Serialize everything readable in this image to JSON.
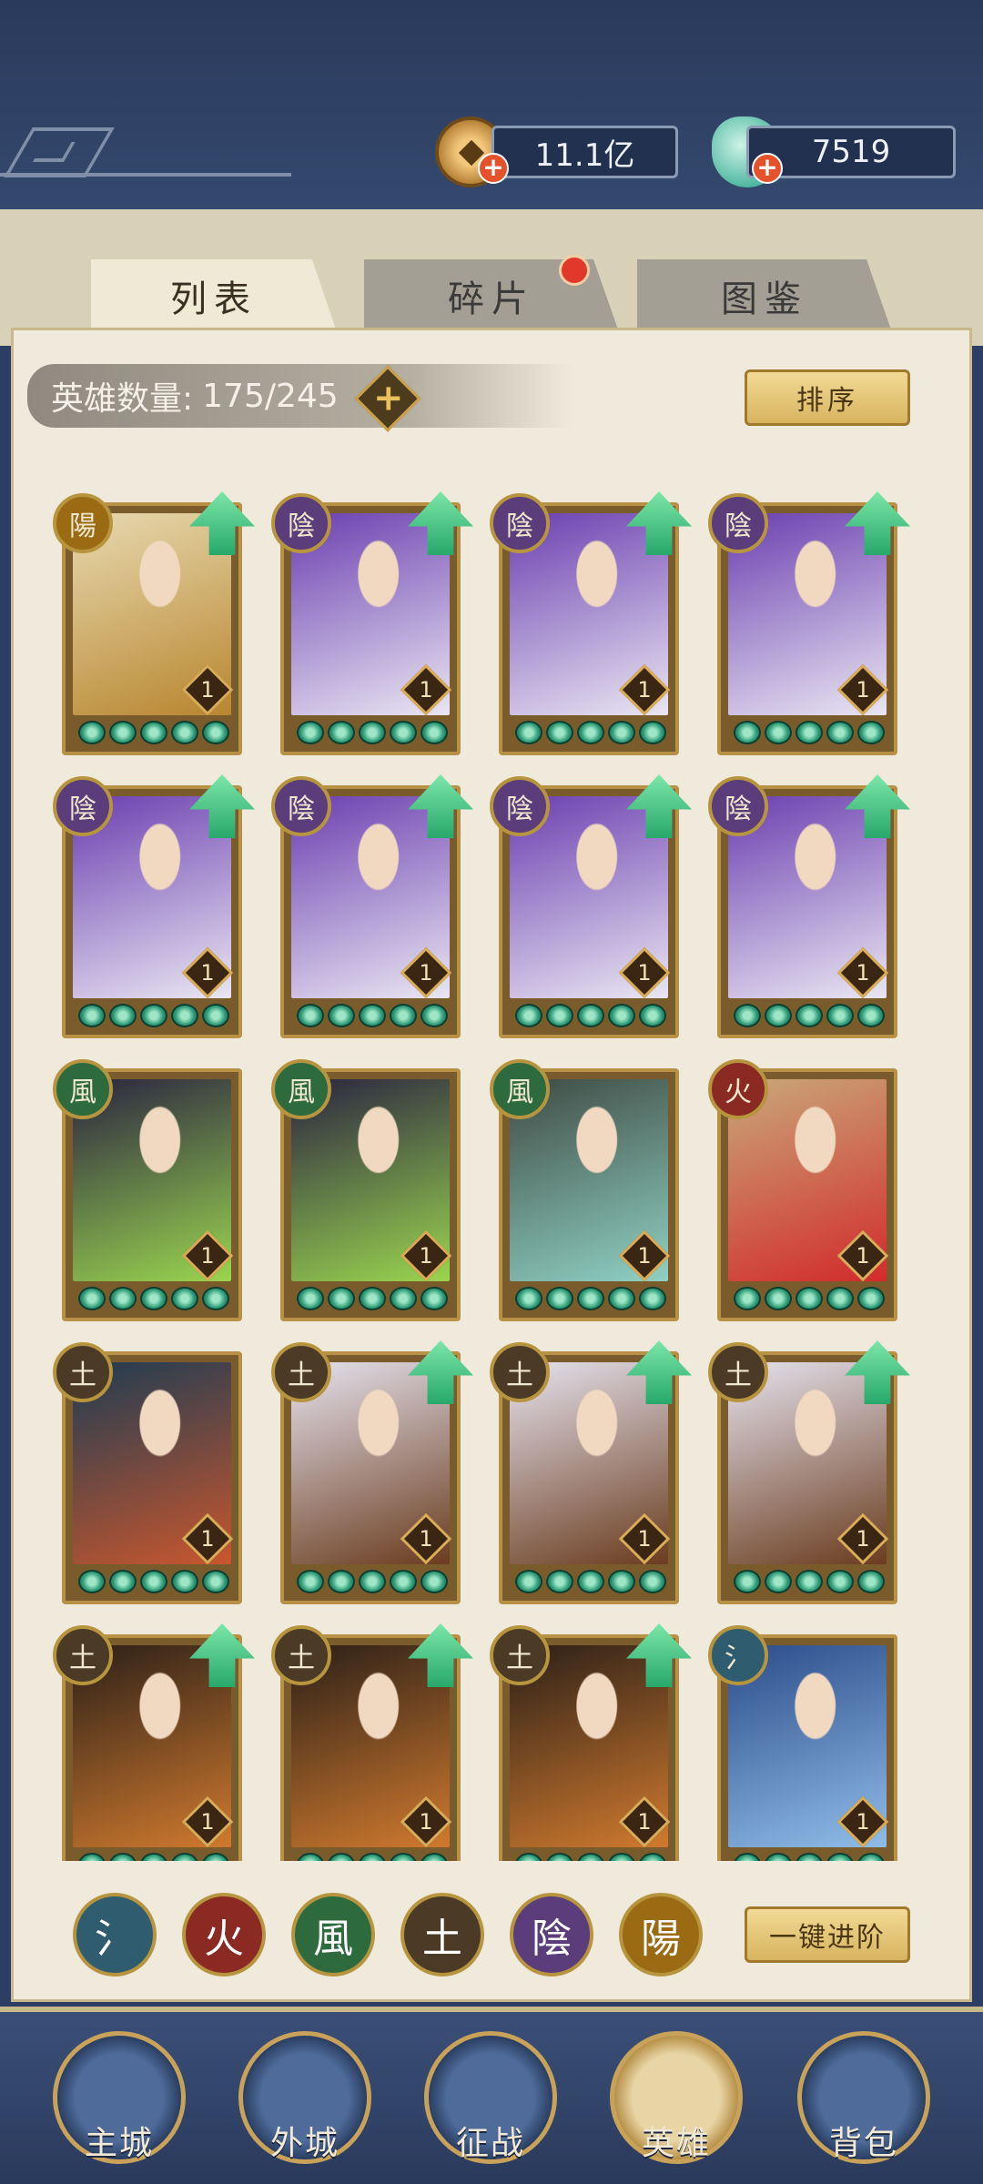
{
  "resources": {
    "coins": "11.1亿",
    "jade": "7519"
  },
  "tabs": [
    {
      "label": "列表",
      "active": true
    },
    {
      "label": "碎片",
      "active": false,
      "has_badge": true
    },
    {
      "label": "图鉴",
      "active": false
    }
  ],
  "hero_count": {
    "label": "英雄数量:",
    "value": "175/245"
  },
  "buttons": {
    "sort": "排序",
    "one_click_advance": "一键进阶"
  },
  "element_glyphs": {
    "water": "氵",
    "fire": "火",
    "wind": "風",
    "earth": "土",
    "yin": "陰",
    "yang": "陽"
  },
  "element_colors": {
    "water": "#2f5c6e",
    "fire": "#8a2a22",
    "wind": "#2d6b3e",
    "earth": "#4a3a26",
    "yin": "#5a3d7a",
    "yang": "#9a6b12"
  },
  "heroes": [
    {
      "element": "yang",
      "level": "1",
      "stars": 5,
      "upgrade": true,
      "art": "yellow-robed-lady"
    },
    {
      "element": "yin",
      "level": "1",
      "stars": 5,
      "upgrade": true,
      "art": "purple-ninja"
    },
    {
      "element": "yin",
      "level": "1",
      "stars": 5,
      "upgrade": true,
      "art": "purple-ninja"
    },
    {
      "element": "yin",
      "level": "1",
      "stars": 5,
      "upgrade": true,
      "art": "purple-ninja"
    },
    {
      "element": "yin",
      "level": "1",
      "stars": 5,
      "upgrade": true,
      "art": "purple-ninja"
    },
    {
      "element": "yin",
      "level": "1",
      "stars": 5,
      "upgrade": true,
      "art": "purple-ninja"
    },
    {
      "element": "yin",
      "level": "1",
      "stars": 5,
      "upgrade": true,
      "art": "purple-ninja"
    },
    {
      "element": "yin",
      "level": "1",
      "stars": 5,
      "upgrade": true,
      "art": "purple-ninja"
    },
    {
      "element": "wind",
      "level": "1",
      "stars": 5,
      "upgrade": false,
      "art": "twin-tail-girl"
    },
    {
      "element": "wind",
      "level": "1",
      "stars": 5,
      "upgrade": false,
      "art": "twin-tail-girl"
    },
    {
      "element": "wind",
      "level": "1",
      "stars": 5,
      "upgrade": false,
      "art": "long-hair-swordsman"
    },
    {
      "element": "fire",
      "level": "1",
      "stars": 5,
      "upgrade": false,
      "art": "red-dress-girl"
    },
    {
      "element": "earth",
      "level": "1",
      "stars": 5,
      "upgrade": false,
      "art": "scarf-youth"
    },
    {
      "element": "earth",
      "level": "1",
      "stars": 5,
      "upgrade": true,
      "art": "bearded-general"
    },
    {
      "element": "earth",
      "level": "1",
      "stars": 5,
      "upgrade": true,
      "art": "bearded-general"
    },
    {
      "element": "earth",
      "level": "1",
      "stars": 5,
      "upgrade": true,
      "art": "bearded-general"
    },
    {
      "element": "earth",
      "level": "1",
      "stars": 5,
      "upgrade": true,
      "art": "leaf-dancer"
    },
    {
      "element": "earth",
      "level": "1",
      "stars": 5,
      "upgrade": true,
      "art": "leaf-dancer"
    },
    {
      "element": "earth",
      "level": "1",
      "stars": 5,
      "upgrade": true,
      "art": "leaf-dancer"
    },
    {
      "element": "water",
      "level": "1",
      "stars": 5,
      "upgrade": false,
      "art": "blue-opera-lady"
    }
  ],
  "art_colors": {
    "yellow-robed-lady": [
      "#e7d9b0",
      "#b8862f"
    ],
    "purple-ninja": [
      "#6b3fb0",
      "#e9e6f2"
    ],
    "twin-tail-girl": [
      "#2a2440",
      "#9ad54f"
    ],
    "long-hair-swordsman": [
      "#3f4b44",
      "#8fd1c3"
    ],
    "red-dress-girl": [
      "#c9a87a",
      "#d22b2b"
    ],
    "scarf-youth": [
      "#1f3c52",
      "#c8572e"
    ],
    "bearded-general": [
      "#e6e2ee",
      "#6a3c1e"
    ],
    "leaf-dancer": [
      "#2c2018",
      "#d07a2e"
    ],
    "blue-opera-lady": [
      "#2c4c8a",
      "#8fbde8"
    ]
  },
  "filters": [
    "water",
    "fire",
    "wind",
    "earth",
    "yin",
    "yang"
  ],
  "nav": [
    {
      "label": "主城",
      "active": false
    },
    {
      "label": "外城",
      "active": false
    },
    {
      "label": "征战",
      "active": false
    },
    {
      "label": "英雄",
      "active": true
    },
    {
      "label": "背包",
      "active": false
    }
  ]
}
